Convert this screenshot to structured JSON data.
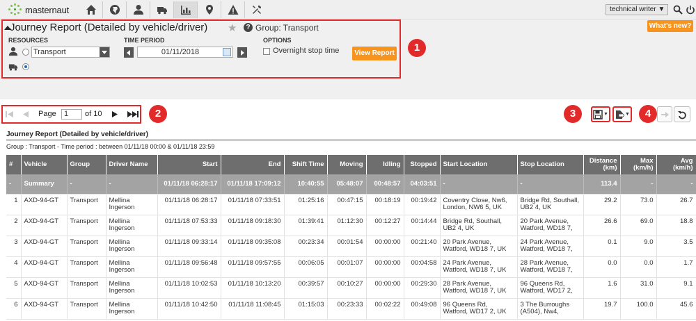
{
  "brand": {
    "name": "masternaut"
  },
  "topbar": {
    "nav_icons": [
      "home-icon",
      "globe-icon",
      "person-icon",
      "truck-icon",
      "bar-chart-icon",
      "map-pin-icon",
      "warning-icon",
      "tools-icon"
    ],
    "active_icon": "bar-chart-icon",
    "user": "technical writer ▼",
    "search_icon": "search-icon",
    "power_icon": "power-icon",
    "whats_new": "What's new?"
  },
  "header": {
    "title": "Journey Report (Detailed by vehicle/driver)",
    "group_label": "Group: Transport",
    "resources_label": "RESOURCES",
    "resource_value": "Transport",
    "time_period_label": "TIME PERIOD",
    "date_value": "01/11/2018",
    "options_label": "OPTIONS",
    "overnight_label": "Overnight stop time",
    "view_report": "View Report"
  },
  "annotations": {
    "b1": "1",
    "b2": "2",
    "b3": "3",
    "b4": "4"
  },
  "pager": {
    "page_label": "Page",
    "page_value": "1",
    "of_label": "of 10"
  },
  "report": {
    "title": "Journey Report (Detailed by vehicle/driver)",
    "subtitle": "Group : Transport - Time period : between 01/11/18 00:00 & 01/11/18 23:59",
    "columns": [
      "#",
      "Vehicle",
      "Group",
      "Driver Name",
      "Start",
      "End",
      "Shift Time",
      "Moving",
      "Idling",
      "Stopped",
      "Start Location",
      "Stop Location",
      "Distance (km)",
      "Max (km/h)",
      "Avg (km/h)"
    ],
    "summary": [
      "-",
      "Summary",
      "-",
      "-",
      "01/11/18 06:28:17",
      "01/11/18 17:09:12",
      "10:40:55",
      "05:48:07",
      "00:48:57",
      "04:03:51",
      "-",
      "-",
      "113.4",
      "-",
      "-"
    ],
    "rows": [
      [
        "1",
        "AXD-94-GT",
        "Transport",
        "Mellina Ingerson",
        "01/11/18 06:28:17",
        "01/11/18 07:33:51",
        "01:25:16",
        "00:47:15",
        "00:18:19",
        "00:19:42",
        "Coventry Close, Nw6, London, NW6 5, UK",
        "Bridge Rd, Southall, UB2 4, UK",
        "29.2",
        "73.0",
        "26.7"
      ],
      [
        "2",
        "AXD-94-GT",
        "Transport",
        "Mellina Ingerson",
        "01/11/18 07:53:33",
        "01/11/18 09:18:30",
        "01:39:41",
        "01:12:30",
        "00:12:27",
        "00:14:44",
        "Bridge Rd, Southall, UB2 4, UK",
        "20 Park Avenue, Watford, WD18 7,",
        "26.6",
        "69.0",
        "18.8"
      ],
      [
        "3",
        "AXD-94-GT",
        "Transport",
        "Mellina Ingerson",
        "01/11/18 09:33:14",
        "01/11/18 09:35:08",
        "00:23:34",
        "00:01:54",
        "00:00:00",
        "00:21:40",
        "20 Park Avenue, Watford, WD18 7, UK",
        "24 Park Avenue, Watford, WD18 7,",
        "0.1",
        "9.0",
        "3.5"
      ],
      [
        "4",
        "AXD-94-GT",
        "Transport",
        "Mellina Ingerson",
        "01/11/18 09:56:48",
        "01/11/18 09:57:55",
        "00:06:05",
        "00:01:07",
        "00:00:00",
        "00:04:58",
        "24 Park Avenue, Watford, WD18 7, UK",
        "28 Park Avenue, Watford, WD18 7,",
        "0.0",
        "0.0",
        "1.7"
      ],
      [
        "5",
        "AXD-94-GT",
        "Transport",
        "Mellina Ingerson",
        "01/11/18 10:02:53",
        "01/11/18 10:13:20",
        "00:39:57",
        "00:10:27",
        "00:00:00",
        "00:29:30",
        "28 Park Avenue, Watford, WD18 7, UK",
        "96 Queens Rd, Watford, WD17 2,",
        "1.6",
        "31.0",
        "9.1"
      ],
      [
        "6",
        "AXD-94-GT",
        "Transport",
        "Mellina Ingerson",
        "01/11/18 10:42:50",
        "01/11/18 11:08:45",
        "01:15:03",
        "00:23:33",
        "00:02:22",
        "00:49:08",
        "96 Queens Rd, Watford, WD17 2, UK",
        "3 The Burroughs (A504), Nw4,",
        "19.7",
        "100.0",
        "45.6"
      ]
    ]
  },
  "colors": {
    "accent": "#f7941d",
    "highlight": "#e32a2a",
    "header_bg": "#6e6e6e",
    "summary_bg": "#a3a3a3"
  }
}
